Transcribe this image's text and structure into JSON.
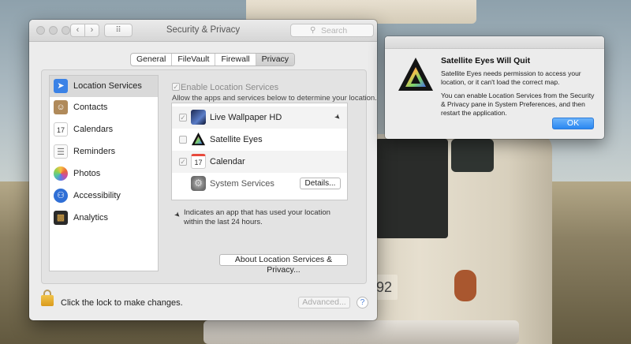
{
  "window": {
    "title": "Security & Privacy",
    "search_placeholder": "Search",
    "nav_back": "‹",
    "nav_forward": "›",
    "grid_glyph": "⠿"
  },
  "tabs": [
    {
      "label": "General",
      "active": false
    },
    {
      "label": "FileVault",
      "active": false
    },
    {
      "label": "Firewall",
      "active": false
    },
    {
      "label": "Privacy",
      "active": true
    }
  ],
  "sidebar": {
    "items": [
      {
        "label": "Location Services",
        "icon": "location-arrow-icon",
        "selected": true
      },
      {
        "label": "Contacts",
        "icon": "contacts-icon",
        "selected": false
      },
      {
        "label": "Calendars",
        "icon": "calendar-icon",
        "selected": false
      },
      {
        "label": "Reminders",
        "icon": "reminders-icon",
        "selected": false
      },
      {
        "label": "Photos",
        "icon": "photos-icon",
        "selected": false
      },
      {
        "label": "Accessibility",
        "icon": "accessibility-icon",
        "selected": false
      },
      {
        "label": "Analytics",
        "icon": "analytics-icon",
        "selected": false
      }
    ]
  },
  "location": {
    "enable_label": "Enable Location Services",
    "enable_checked": true,
    "allow_text": "Allow the apps and services below to determine your location.",
    "apps": [
      {
        "label": "Live Wallpaper HD",
        "checked": true,
        "recent_use": true
      },
      {
        "label": "Satellite Eyes",
        "checked": false,
        "recent_use": false
      },
      {
        "label": "Calendar",
        "checked": true,
        "recent_use": false
      },
      {
        "label": "System Services",
        "checked": false,
        "recent_use": false
      }
    ],
    "calendar_day": "17",
    "details_label": "Details...",
    "note": "Indicates an app that has used your location within the last 24 hours.",
    "about_label": "About Location Services & Privacy..."
  },
  "footer": {
    "lock_text": "Click the lock to make changes.",
    "advanced_label": "Advanced...",
    "help_label": "?"
  },
  "alert": {
    "title": "Satellite Eyes Will Quit",
    "message1": "Satellite Eyes needs permission to access your location, or it can't load the correct map.",
    "message2": "You can enable Location Services from the Security & Privacy pane in System Preferences, and then restart the application.",
    "ok_label": "OK"
  },
  "background": {
    "plate_text": "92"
  },
  "colors": {
    "accent": "#2a87f1",
    "selection": "#d9d9d9"
  }
}
